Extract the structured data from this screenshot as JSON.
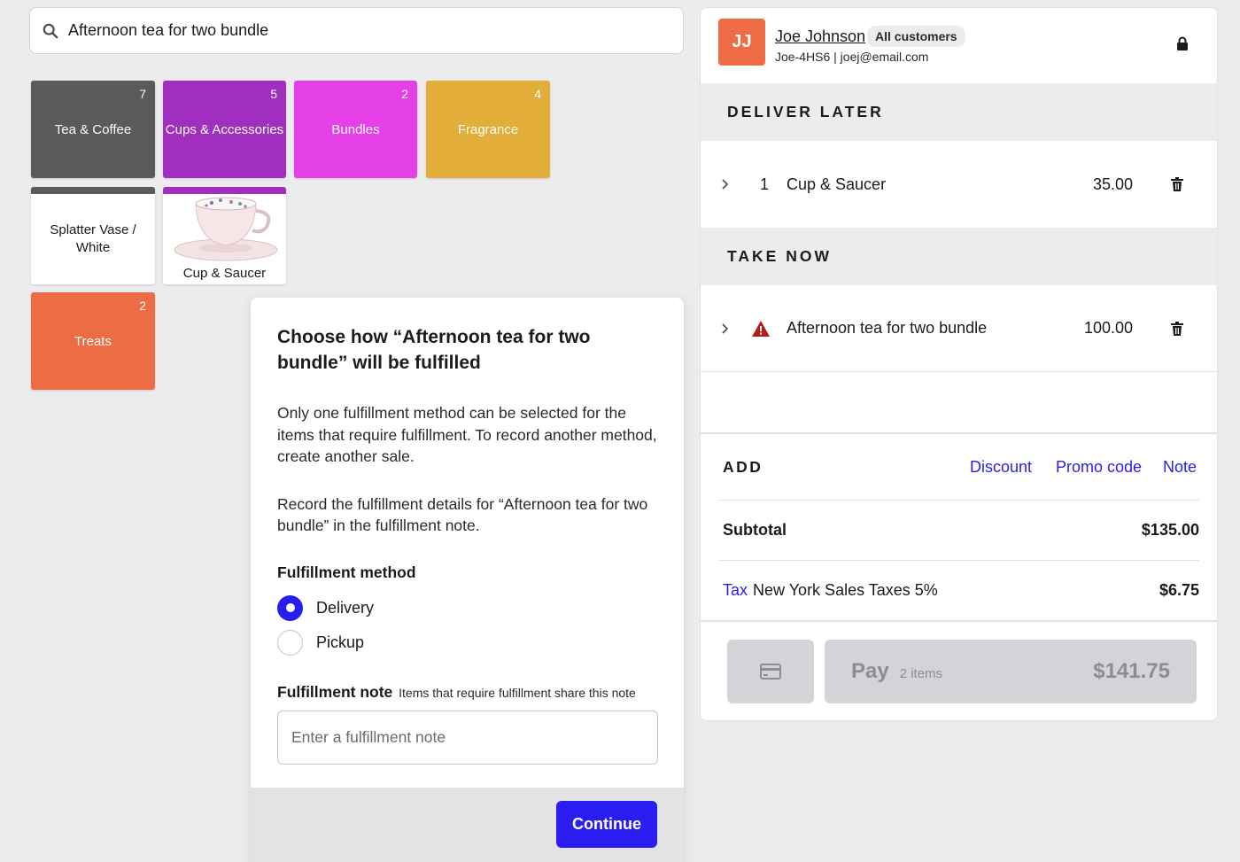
{
  "search": {
    "value": "Afternoon tea for two bundle"
  },
  "tiles": [
    {
      "label": "Tea & Coffee",
      "count": "7",
      "color": "#5a5a5a"
    },
    {
      "label": "Cups & Accessories",
      "count": "5",
      "color": "#a02fc0"
    },
    {
      "label": "Bundles",
      "count": "2",
      "color": "#e540e8"
    },
    {
      "label": "Fragrance",
      "count": "4",
      "color": "#e2ad38"
    },
    {
      "label": "Splatter Vase / White"
    },
    {
      "label": "Cup & Saucer"
    },
    {
      "label": "Treats",
      "count": "2",
      "color": "#ee6c45"
    }
  ],
  "modal": {
    "title": "Choose how “Afternoon tea for two bundle” will be fulfilled",
    "para1": "Only one fulfillment method can be selected for the items that require fulfillment. To record another method, create another sale.",
    "para2": "Record the fulfillment details for “Afternoon tea for two bundle” in the fulfillment note.",
    "method_title": "Fulfillment method",
    "options": [
      "Delivery",
      "Pickup"
    ],
    "selected": "Delivery",
    "note_title": "Fulfillment note",
    "note_hint": "Items that require fulfillment share this note",
    "note_placeholder": "Enter a fulfillment note",
    "continue_label": "Continue",
    "accent": "#2a1df0"
  },
  "customer": {
    "initials": "JJ",
    "name": "Joe Johnson",
    "group": "All customers",
    "sub": "Joe-4HS6 | joej@email.com"
  },
  "sections": {
    "deliver_later": "DELIVER LATER",
    "take_now": "TAKE NOW"
  },
  "deliver_items": [
    {
      "qty": "1",
      "name": "Cup & Saucer",
      "price": "35.00"
    }
  ],
  "take_items": [
    {
      "name": "Afternoon tea for two bundle",
      "price": "100.00",
      "warning": true
    }
  ],
  "add": {
    "label": "ADD",
    "discount": "Discount",
    "promo": "Promo code",
    "note": "Note"
  },
  "totals": {
    "subtotal_label": "Subtotal",
    "subtotal": "$135.00",
    "tax_link": "Tax",
    "tax_desc": "New York Sales Taxes 5%",
    "tax": "$6.75"
  },
  "pay": {
    "label": "Pay",
    "items": "2 items",
    "total": "$141.75"
  }
}
